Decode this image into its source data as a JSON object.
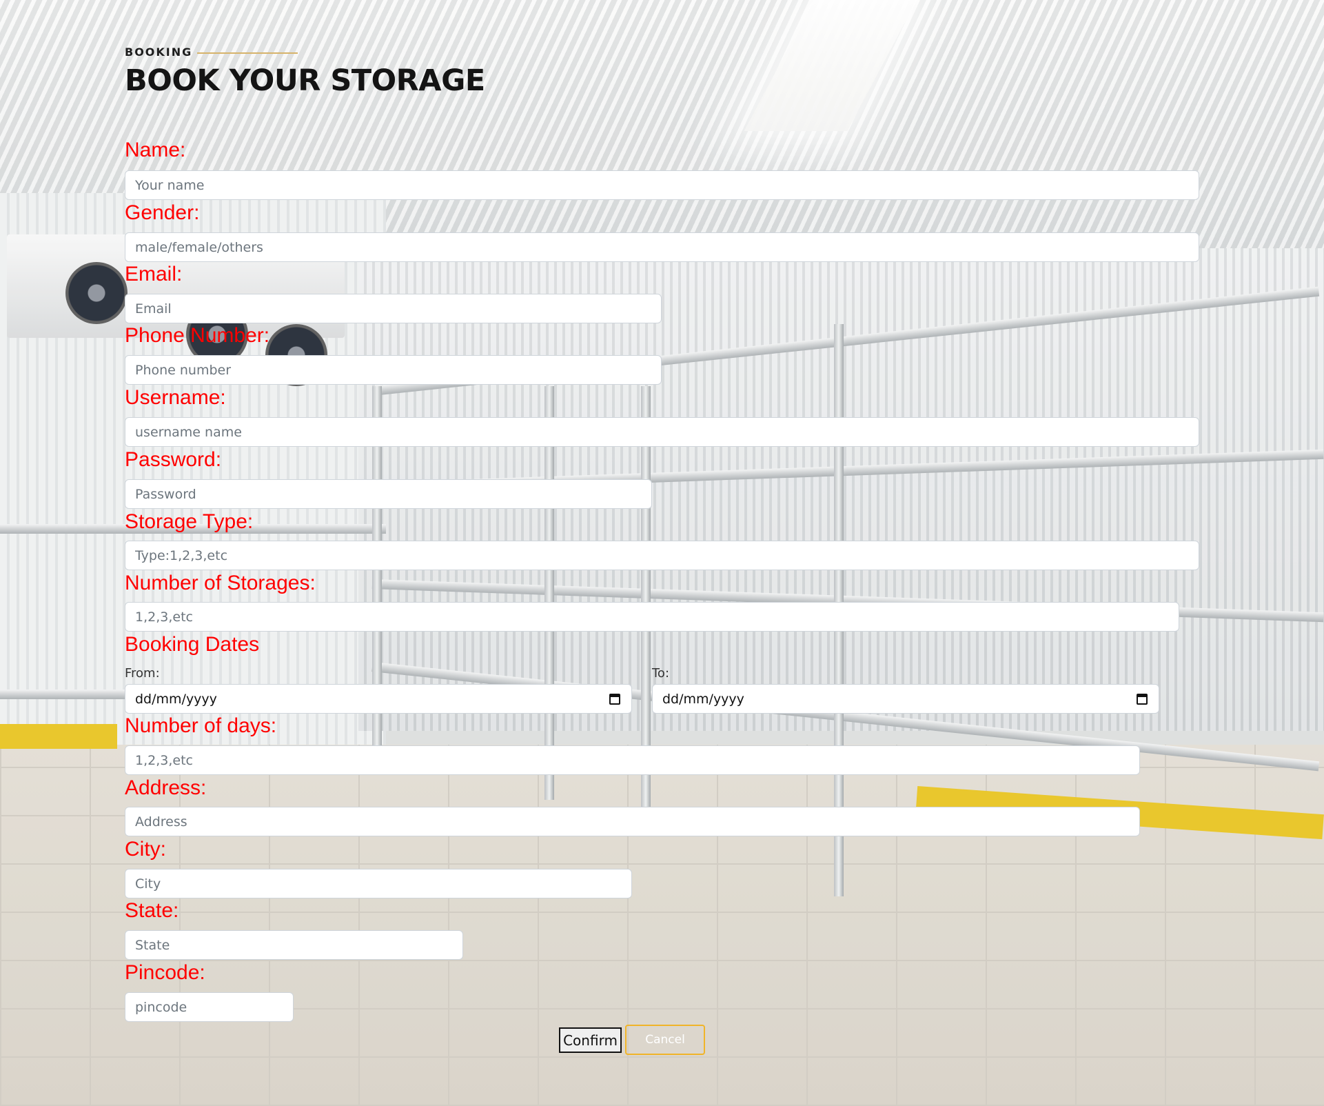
{
  "header": {
    "kicker": "BOOKING",
    "title": "BOOK YOUR STORAGE"
  },
  "form": {
    "name": {
      "label": "Name:",
      "placeholder": "Your name"
    },
    "gender": {
      "label": "Gender:",
      "placeholder": "male/female/others"
    },
    "email": {
      "label": "Email:",
      "placeholder": "Email"
    },
    "phone": {
      "label": "Phone Number:",
      "placeholder": "Phone number"
    },
    "username": {
      "label": "Username:",
      "placeholder": "username name"
    },
    "password": {
      "label": "Password:",
      "placeholder": "Password"
    },
    "storage_type": {
      "label": "Storage Type:",
      "placeholder": "Type:1,2,3,etc"
    },
    "num_storages": {
      "label": "Number of Storages:",
      "placeholder": "1,2,3,etc"
    },
    "booking_dates": {
      "label": "Booking Dates",
      "from_label": "From:",
      "from_value": "dd/mm/yyyy",
      "to_label": "To:",
      "to_value": "dd/mm/yyyy"
    },
    "num_days": {
      "label": "Number of days:",
      "placeholder": "1,2,3,etc"
    },
    "address": {
      "label": "Address:",
      "placeholder": "Address"
    },
    "city": {
      "label": "City:",
      "placeholder": "City"
    },
    "state": {
      "label": "State:",
      "placeholder": "State"
    },
    "pincode": {
      "label": "Pincode:",
      "placeholder": "pincode"
    }
  },
  "actions": {
    "confirm_label": "Confirm",
    "cancel_label": "Cancel"
  },
  "colors": {
    "label": "#ff0000",
    "cancel_border": "#f0b429",
    "kicker_line": "#d6b36a"
  }
}
